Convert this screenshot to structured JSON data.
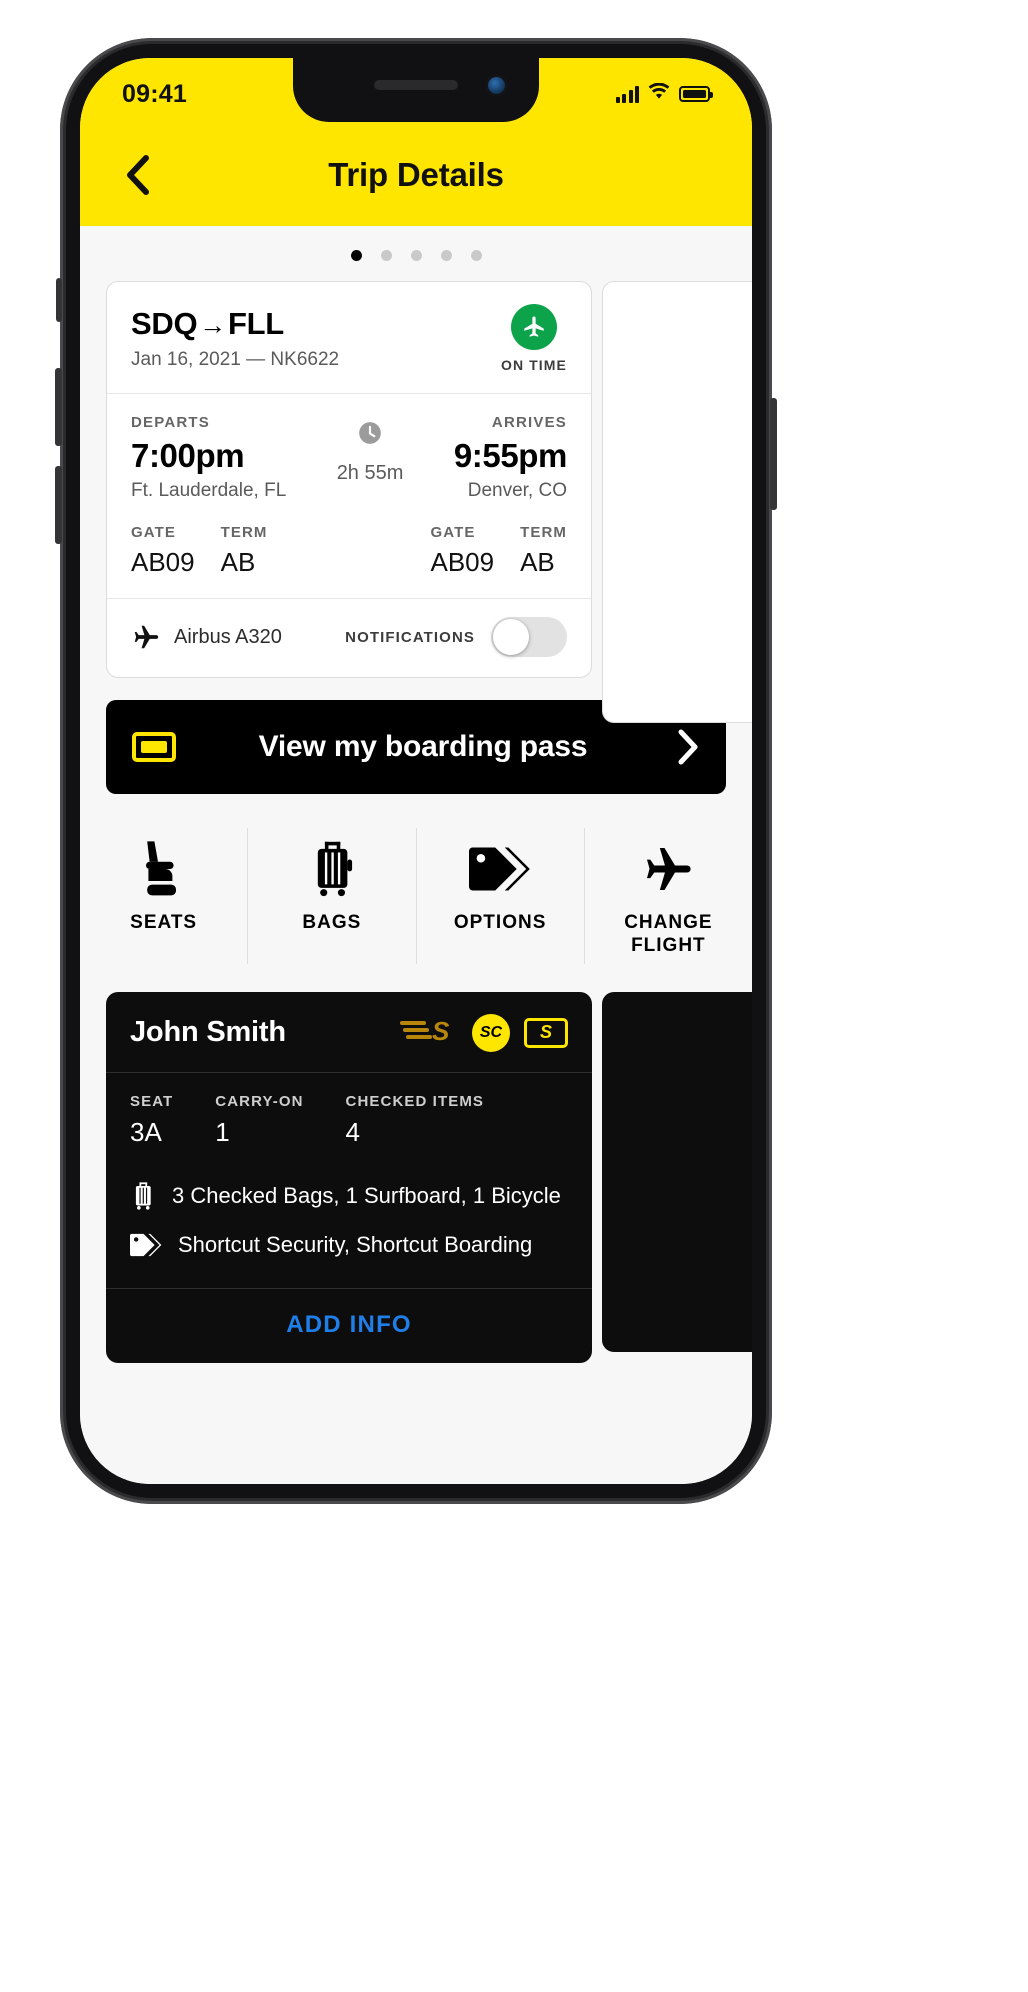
{
  "status_bar": {
    "time": "09:41",
    "signal_icon": "cellular-signal-icon",
    "wifi_icon": "wifi-icon",
    "battery_icon": "battery-icon"
  },
  "header": {
    "back_icon": "chevron-left-icon",
    "title": "Trip Details",
    "background": "#ffe600"
  },
  "pager": {
    "count": 5,
    "active_index": 0
  },
  "flight_card": {
    "route_from": "SDQ",
    "route_arrow": "→",
    "route_to": "FLL",
    "sub_line": "Jan 16, 2021 — NK6622",
    "status_label": "ON TIME",
    "status_color": "#0ca34a",
    "status_icon": "plane-icon",
    "departs": {
      "label": "DEPARTS",
      "time": "7:00pm",
      "city": "Ft. Lauderdale, FL",
      "gate_label": "GATE",
      "gate_value": "AB09",
      "term_label": "TERM",
      "term_value": "AB"
    },
    "arrives": {
      "label": "ARRIVES",
      "time": "9:55pm",
      "city": "Denver, CO",
      "gate_label": "GATE",
      "gate_value": "AB09",
      "term_label": "TERM",
      "term_value": "AB"
    },
    "duration": "2h 55m",
    "duration_icon": "clock-icon",
    "aircraft": "Airbus A320",
    "aircraft_icon": "plane-icon",
    "notifications_label": "NOTIFICATIONS",
    "notifications_on": false
  },
  "boarding_pass_button": {
    "label": "View my boarding pass",
    "left_icon": "boarding-pass-ticket-icon",
    "right_icon": "chevron-right-icon"
  },
  "quick_actions": [
    {
      "label": "SEATS",
      "icon": "seat-icon"
    },
    {
      "label": "BAGS",
      "icon": "suitcase-icon"
    },
    {
      "label": "OPTIONS",
      "icon": "tags-icon"
    },
    {
      "label": "CHANGE FLIGHT",
      "icon": "plane-icon"
    }
  ],
  "passenger_card": {
    "name": "John Smith",
    "badges": [
      {
        "name": "wings-s-logo",
        "text": ""
      },
      {
        "name": "shortcut-sc-badge",
        "text": "SC"
      },
      {
        "name": "free-spirit-card-badge",
        "text": "S"
      }
    ],
    "stats": [
      {
        "label": "SEAT",
        "value": "3A"
      },
      {
        "label": "CARRY-ON",
        "value": "1"
      },
      {
        "label": "CHECKED ITEMS",
        "value": "4"
      }
    ],
    "lines": [
      {
        "icon": "suitcase-icon",
        "text": "3 Checked Bags, 1 Surfboard, 1 Bicycle"
      },
      {
        "icon": "tag-icon",
        "text": "Shortcut Security, Shortcut Boarding"
      }
    ],
    "action_label": "ADD INFO",
    "action_color": "#1f7fe8"
  }
}
